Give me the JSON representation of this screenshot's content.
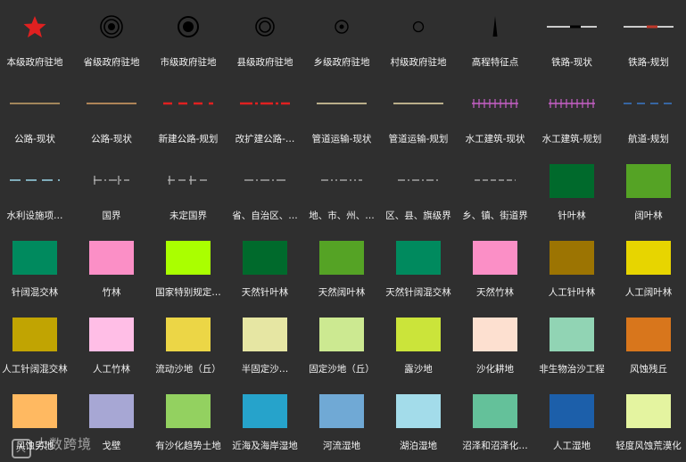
{
  "legend": {
    "items": [
      {
        "label": "本级政府驻地",
        "icon": "red-star-icon",
        "color": "#e02020"
      },
      {
        "label": "省级政府驻地",
        "icon": "triple-ring-icon",
        "color": "#000000"
      },
      {
        "label": "市级政府驻地",
        "icon": "bullseye-icon",
        "color": "#000000"
      },
      {
        "label": "县级政府驻地",
        "icon": "double-ring-icon",
        "color": "#000000"
      },
      {
        "label": "乡级政府驻地",
        "icon": "dot-ring-icon",
        "color": "#000000"
      },
      {
        "label": "村级政府驻地",
        "icon": "small-ring-icon",
        "color": "#000000"
      },
      {
        "label": "高程特征点",
        "icon": "elevation-point-icon",
        "color": "#000000"
      },
      {
        "label": "铁路-现状",
        "icon": "railway-existing-icon",
        "color": "#ffffff"
      },
      {
        "label": "铁路-规划",
        "icon": "railway-planned-icon",
        "color": "#c0392b"
      },
      {
        "label": "公路-现状",
        "icon": "highway-existing-icon",
        "color": "#c9a36a"
      },
      {
        "label": "公路-现状",
        "icon": "highway-existing-icon",
        "color": "#d9a066"
      },
      {
        "label": "新建公路-规划",
        "icon": "new-highway-planned-icon",
        "color": "#e02020"
      },
      {
        "label": "改扩建公路-…",
        "icon": "rebuild-highway-planned-icon",
        "color": "#e02020"
      },
      {
        "label": "管道运输-现状",
        "icon": "pipeline-existing-icon",
        "color": "#e8d9a8"
      },
      {
        "label": "管道运输-规划",
        "icon": "pipeline-planned-icon",
        "color": "#e8d9a8"
      },
      {
        "label": "水工建筑-现状",
        "icon": "hydraulic-structure-existing-icon",
        "color": "#c860c8"
      },
      {
        "label": "水工建筑-规划",
        "icon": "hydraulic-structure-planned-icon",
        "color": "#c860c8"
      },
      {
        "label": "航道-规划",
        "icon": "waterway-planned-icon",
        "color": "#3a78c8"
      },
      {
        "label": "水利设施项…",
        "icon": "water-facility-icon",
        "color": "#9ad6e8"
      },
      {
        "label": "国界",
        "icon": "national-boundary-icon",
        "color": "#bbbbbb"
      },
      {
        "label": "未定国界",
        "icon": "undetermined-boundary-icon",
        "color": "#bbbbbb"
      },
      {
        "label": "省、自治区、…",
        "icon": "province-boundary-icon",
        "color": "#bbbbbb"
      },
      {
        "label": "地、市、州、…",
        "icon": "prefecture-boundary-icon",
        "color": "#bbbbbb"
      },
      {
        "label": "区、县、旗级界",
        "icon": "county-boundary-icon",
        "color": "#bbbbbb"
      },
      {
        "label": "乡、镇、街道界",
        "icon": "township-boundary-icon",
        "color": "#bbbbbb"
      },
      {
        "label": "针叶林",
        "icon": "swatch",
        "color": "#006a2c"
      },
      {
        "label": "阔叶林",
        "icon": "swatch",
        "color": "#55a325"
      },
      {
        "label": "针阔混交林",
        "icon": "swatch",
        "color": "#008a5e"
      },
      {
        "label": "竹林",
        "icon": "swatch",
        "color": "#fb8fc6"
      },
      {
        "label": "国家特别规定…",
        "icon": "swatch",
        "color": "#aaff00"
      },
      {
        "label": "天然针叶林",
        "icon": "swatch",
        "color": "#006a2c"
      },
      {
        "label": "天然阔叶林",
        "icon": "swatch",
        "color": "#55a325"
      },
      {
        "label": "天然针阔混交林",
        "icon": "swatch",
        "color": "#008a5e"
      },
      {
        "label": "天然竹林",
        "icon": "swatch",
        "color": "#fb8fc6"
      },
      {
        "label": "人工针叶林",
        "icon": "swatch",
        "color": "#9c7402"
      },
      {
        "label": "人工阔叶林",
        "icon": "swatch",
        "color": "#e7d500"
      },
      {
        "label": "人工针阔混交林",
        "icon": "swatch",
        "color": "#c1a402"
      },
      {
        "label": "人工竹林",
        "icon": "swatch",
        "color": "#ffbee6"
      },
      {
        "label": "流动沙地（丘）",
        "icon": "swatch",
        "color": "#ecd646"
      },
      {
        "label": "半固定沙…",
        "icon": "swatch",
        "color": "#e6e6a3"
      },
      {
        "label": "固定沙地（丘）",
        "icon": "swatch",
        "color": "#cce991"
      },
      {
        "label": "露沙地",
        "icon": "swatch",
        "color": "#cbe43a"
      },
      {
        "label": "沙化耕地",
        "icon": "swatch",
        "color": "#fde0d0"
      },
      {
        "label": "非生物治沙工程",
        "icon": "swatch",
        "color": "#91d4b4"
      },
      {
        "label": "风蚀残丘",
        "icon": "swatch",
        "color": "#d8761c"
      },
      {
        "label": "风蚀劣地",
        "icon": "swatch",
        "color": "#ffb961"
      },
      {
        "label": "戈壁",
        "icon": "swatch",
        "color": "#a7a7d4"
      },
      {
        "label": "有沙化趋势土地",
        "icon": "swatch",
        "color": "#93d160"
      },
      {
        "label": "近海及海岸湿地",
        "icon": "swatch",
        "color": "#26a3cb"
      },
      {
        "label": "河流湿地",
        "icon": "swatch",
        "color": "#70a9d5"
      },
      {
        "label": "湖泊湿地",
        "icon": "swatch",
        "color": "#a3dcea"
      },
      {
        "label": "沼泽和沼泽化…",
        "icon": "swatch",
        "color": "#64c19a"
      },
      {
        "label": "人工湿地",
        "icon": "swatch",
        "color": "#1c5faa"
      },
      {
        "label": "轻度风蚀荒漠化",
        "icon": "swatch",
        "color": "#e4f4a0"
      }
    ]
  },
  "watermark": {
    "mark": "大",
    "text": "大数跨境"
  }
}
